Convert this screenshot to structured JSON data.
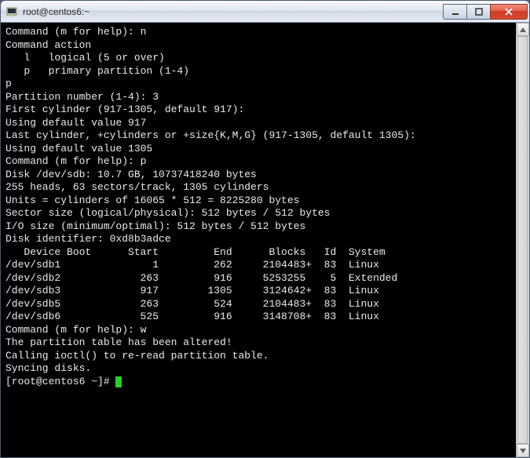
{
  "titlebar": {
    "title": "root@centos6:~"
  },
  "terminal": {
    "lines": {
      "l00": "",
      "l01": "Command (m for help): n",
      "l02": "Command action",
      "l03": "   l   logical (5 or over)",
      "l04": "   p   primary partition (1-4)",
      "l05": "p",
      "l06": "Partition number (1-4): 3",
      "l07": "First cylinder (917-1305, default 917):",
      "l08": "Using default value 917",
      "l09": "Last cylinder, +cylinders or +size{K,M,G} (917-1305, default 1305):",
      "l10": "Using default value 1305",
      "l11": "",
      "l12": "Command (m for help): p",
      "l13": "",
      "l14": "Disk /dev/sdb: 10.7 GB, 10737418240 bytes",
      "l15": "255 heads, 63 sectors/track, 1305 cylinders",
      "l16": "Units = cylinders of 16065 * 512 = 8225280 bytes",
      "l17": "Sector size (logical/physical): 512 bytes / 512 bytes",
      "l18": "I/O size (minimum/optimal): 512 bytes / 512 bytes",
      "l19": "Disk identifier: 0xd8b3adce",
      "l20": "",
      "l21": "   Device Boot      Start         End      Blocks   Id  System",
      "l22": "/dev/sdb1               1         262     2104483+  83  Linux",
      "l23": "/dev/sdb2             263         916     5253255    5  Extended",
      "l24": "/dev/sdb3             917        1305     3124642+  83  Linux",
      "l25": "/dev/sdb5             263         524     2104483+  83  Linux",
      "l26": "/dev/sdb6             525         916     3148708+  83  Linux",
      "l27": "",
      "l28": "Command (m for help): w",
      "l29": "The partition table has been altered!",
      "l30": "",
      "l31": "Calling ioctl() to re-read partition table.",
      "l32": "Syncing disks.",
      "l33": "[root@centos6 ~]# "
    }
  }
}
